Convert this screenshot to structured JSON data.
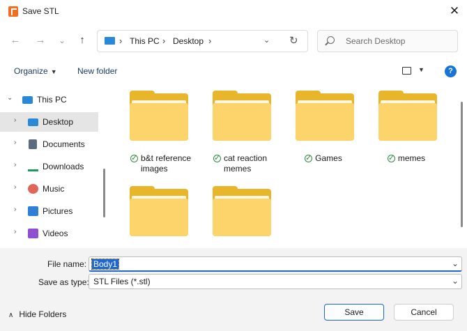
{
  "window": {
    "title": "Save STL",
    "close_glyph": "✕"
  },
  "navbar": {
    "back_glyph": "←",
    "forward_glyph": "→",
    "recent_glyph": "⌄",
    "up_glyph": "↑",
    "breadcrumb": [
      "This PC",
      "Desktop"
    ],
    "breadcrumb_sep": "›",
    "dropdown_glyph": "⌄",
    "refresh_glyph": "↻",
    "search_placeholder": "Search Desktop"
  },
  "commandbar": {
    "organize_label": "Organize",
    "new_folder_label": "New folder",
    "caret": "▼",
    "help_label": "?"
  },
  "sidebar": {
    "items": [
      {
        "label": "This PC",
        "icon": "monitor-icon",
        "expanded": true
      },
      {
        "label": "Desktop",
        "icon": "desktop-icon",
        "selected": true
      },
      {
        "label": "Documents",
        "icon": "documents-icon"
      },
      {
        "label": "Downloads",
        "icon": "downloads-icon"
      },
      {
        "label": "Music",
        "icon": "music-icon"
      },
      {
        "label": "Pictures",
        "icon": "pictures-icon"
      },
      {
        "label": "Videos",
        "icon": "videos-icon"
      }
    ],
    "chevron_right": "›",
    "chevron_down": "⌄"
  },
  "folders": [
    {
      "name_line1": "b&t reference",
      "name_line2": "images",
      "synced": true
    },
    {
      "name_line1": "cat reaction",
      "name_line2": "memes",
      "synced": true
    },
    {
      "name_line1": "Games",
      "name_line2": "",
      "synced": true
    },
    {
      "name_line1": "memes",
      "name_line2": "",
      "synced": true
    },
    {
      "name_line1": "",
      "name_line2": "",
      "synced": false
    },
    {
      "name_line1": "",
      "name_line2": "",
      "synced": false
    }
  ],
  "check_glyph": "✓",
  "form": {
    "file_name_label": "File name:",
    "file_name_value": "Body1",
    "save_type_label": "Save as type:",
    "save_type_value": "STL Files (*.stl)",
    "dropdown_glyph": "⌄"
  },
  "footer": {
    "hide_folders_label": "Hide Folders",
    "hide_folders_caret": "∧",
    "save_label": "Save",
    "cancel_label": "Cancel"
  },
  "colors": {
    "accent": "#1f66d0",
    "folder": "#fcd46b",
    "folder_back": "#e9b52b",
    "sync_green": "#2e8b3d"
  }
}
